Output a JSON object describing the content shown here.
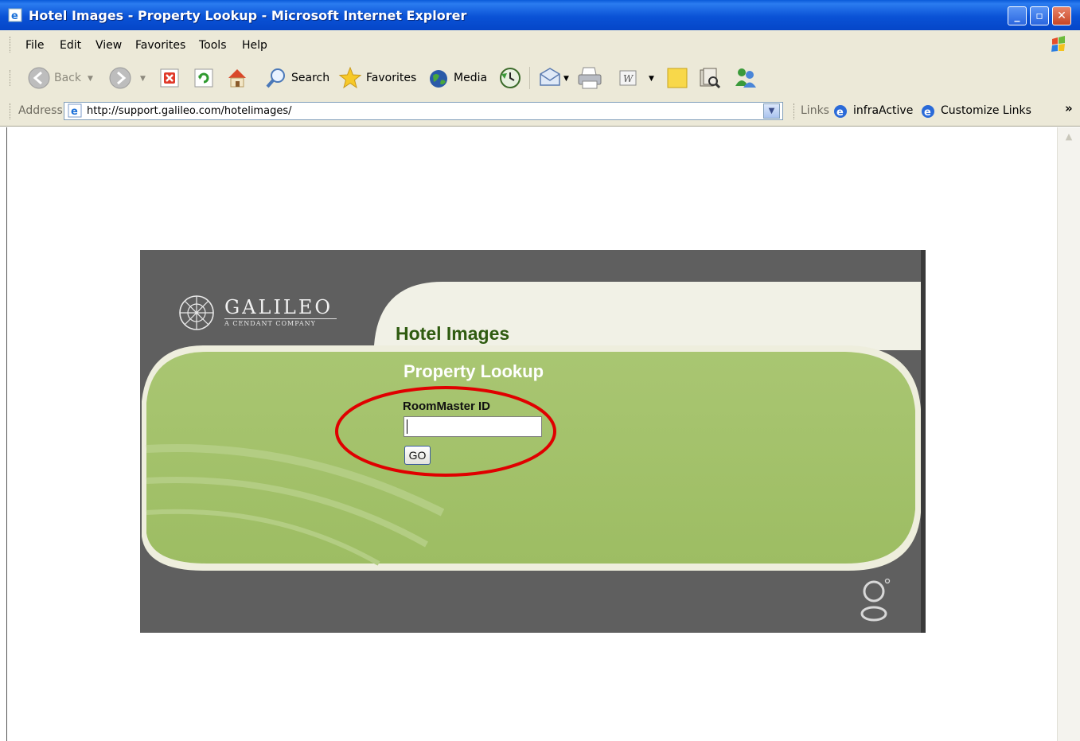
{
  "window": {
    "title": "Hotel Images - Property Lookup - Microsoft Internet Explorer"
  },
  "menu": [
    "File",
    "Edit",
    "View",
    "Favorites",
    "Tools",
    "Help"
  ],
  "toolbar": {
    "back": "Back",
    "search": "Search",
    "favorites": "Favorites",
    "media": "Media"
  },
  "address": {
    "label": "Address",
    "url": "http://support.galileo.com/hotelimages/"
  },
  "links": {
    "label": "Links",
    "items": [
      "infraActive",
      "Customize Links"
    ]
  },
  "page": {
    "logo": {
      "name": "GALILEO",
      "tagline": "A CENDANT COMPANY"
    },
    "heading": "Hotel Images",
    "subheading": "Property Lookup",
    "field_label": "RoomMaster ID",
    "field_value": "",
    "go_button": "GO"
  },
  "colors": {
    "panel": "#5f5f5f",
    "green": "#a2c16a",
    "heading": "#2f5b10",
    "annotation": "#e00000"
  }
}
